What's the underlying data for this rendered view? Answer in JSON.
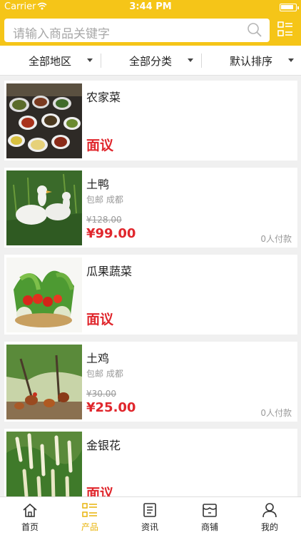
{
  "status_bar": {
    "carrier": "Carrier",
    "time": "3:44 PM"
  },
  "search": {
    "placeholder": "请输入商品关键字"
  },
  "filters": [
    {
      "label": "全部地区"
    },
    {
      "label": "全部分类"
    },
    {
      "label": "默认排序"
    }
  ],
  "products": [
    {
      "name": "农家菜",
      "price_label": "面议"
    },
    {
      "name": "土鸭",
      "shipping": "包邮 成都",
      "original_price": "¥128.00",
      "price": "¥99.00",
      "payers": "0人付款"
    },
    {
      "name": "瓜果蔬菜",
      "price_label": "面议"
    },
    {
      "name": "土鸡",
      "shipping": "包邮 成都",
      "original_price": "¥30.00",
      "price": "¥25.00",
      "payers": "0人付款"
    },
    {
      "name": "金银花",
      "price_label": "面议"
    }
  ],
  "tabs": [
    {
      "label": "首页",
      "icon": "home-icon"
    },
    {
      "label": "产品",
      "icon": "grid-list-icon",
      "active": true
    },
    {
      "label": "资讯",
      "icon": "news-icon"
    },
    {
      "label": "商铺",
      "icon": "shop-icon"
    },
    {
      "label": "我的",
      "icon": "user-icon"
    }
  ],
  "colors": {
    "accent": "#f5c518",
    "price": "#e0262c",
    "active_tab": "#e9b30a"
  }
}
